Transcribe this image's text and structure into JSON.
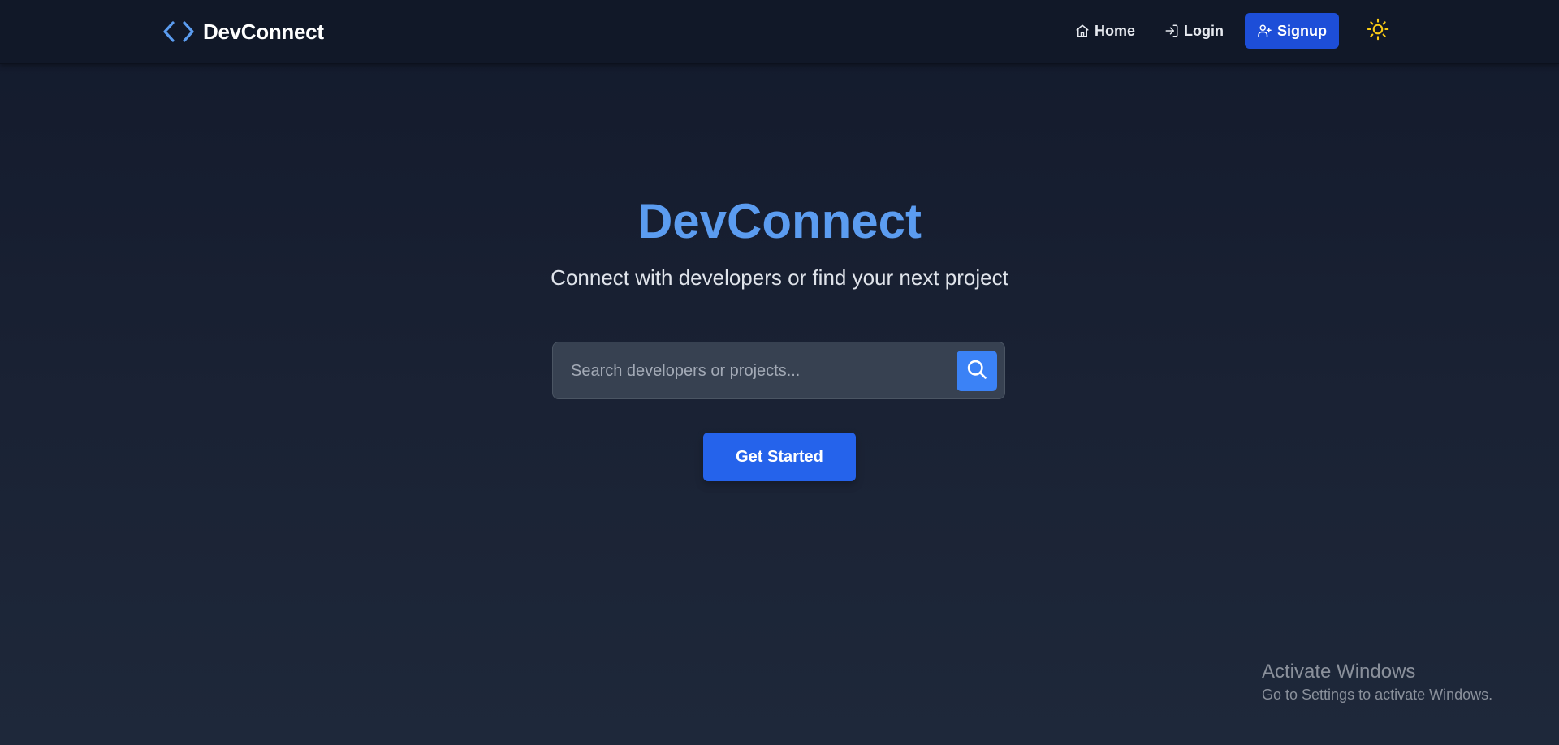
{
  "colors": {
    "accent": "#5b9cf0",
    "primary_button": "#2563eb",
    "signup_button": "#1d4ed8",
    "search_button": "#3b82f6",
    "sun_icon": "#facc15"
  },
  "navbar": {
    "brand": {
      "icon": "code-brackets-icon",
      "label": "DevConnect"
    },
    "links": [
      {
        "icon": "home-icon",
        "label": "Home"
      },
      {
        "icon": "login-icon",
        "label": "Login"
      },
      {
        "icon": "user-plus-icon",
        "label": "Signup"
      }
    ],
    "theme_toggle_icon": "sun-icon"
  },
  "hero": {
    "title": "DevConnect",
    "subtitle": "Connect with developers or find your next project",
    "search": {
      "placeholder": "Search developers or projects...",
      "value": "",
      "button_icon": "search-icon"
    },
    "cta_label": "Get Started"
  },
  "os_watermark": {
    "title": "Activate Windows",
    "subtitle": "Go to Settings to activate Windows."
  }
}
